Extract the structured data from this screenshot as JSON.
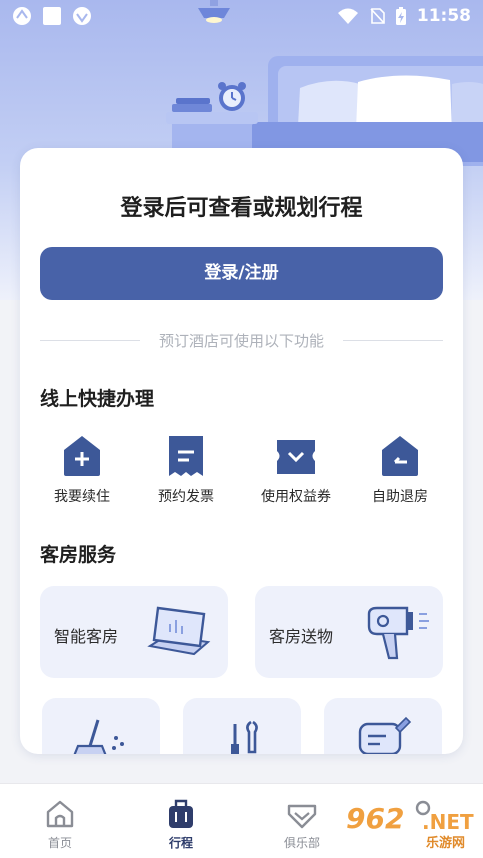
{
  "status_bar": {
    "time": "11:58"
  },
  "card": {
    "title": "登录后可查看或规划行程",
    "login_button": "登录/注册",
    "divider_text": "预订酒店可使用以下功能"
  },
  "quick_section": {
    "title": "线上快捷办理",
    "items": [
      {
        "label": "我要续住",
        "icon": "plus-house-icon"
      },
      {
        "label": "预约发票",
        "icon": "invoice-icon"
      },
      {
        "label": "使用权益券",
        "icon": "coupon-icon"
      },
      {
        "label": "自助退房",
        "icon": "checkout-house-icon"
      }
    ]
  },
  "room_section": {
    "title": "客房服务",
    "items": [
      {
        "label": "智能客房",
        "icon": "tablet-icon"
      },
      {
        "label": "客房送物",
        "icon": "hairdryer-icon"
      }
    ]
  },
  "tabbar": {
    "items": [
      {
        "label": "首页",
        "icon": "home-icon"
      },
      {
        "label": "行程",
        "icon": "luggage-icon"
      },
      {
        "label": "俱乐部",
        "icon": "diamond-icon"
      }
    ]
  },
  "watermark": {
    "number": "962",
    "net": ".NET",
    "text": "乐游网"
  },
  "colors": {
    "primary": "#4862a8",
    "icon_blue": "#3d5898",
    "tile_bg": "#eef1fb"
  }
}
